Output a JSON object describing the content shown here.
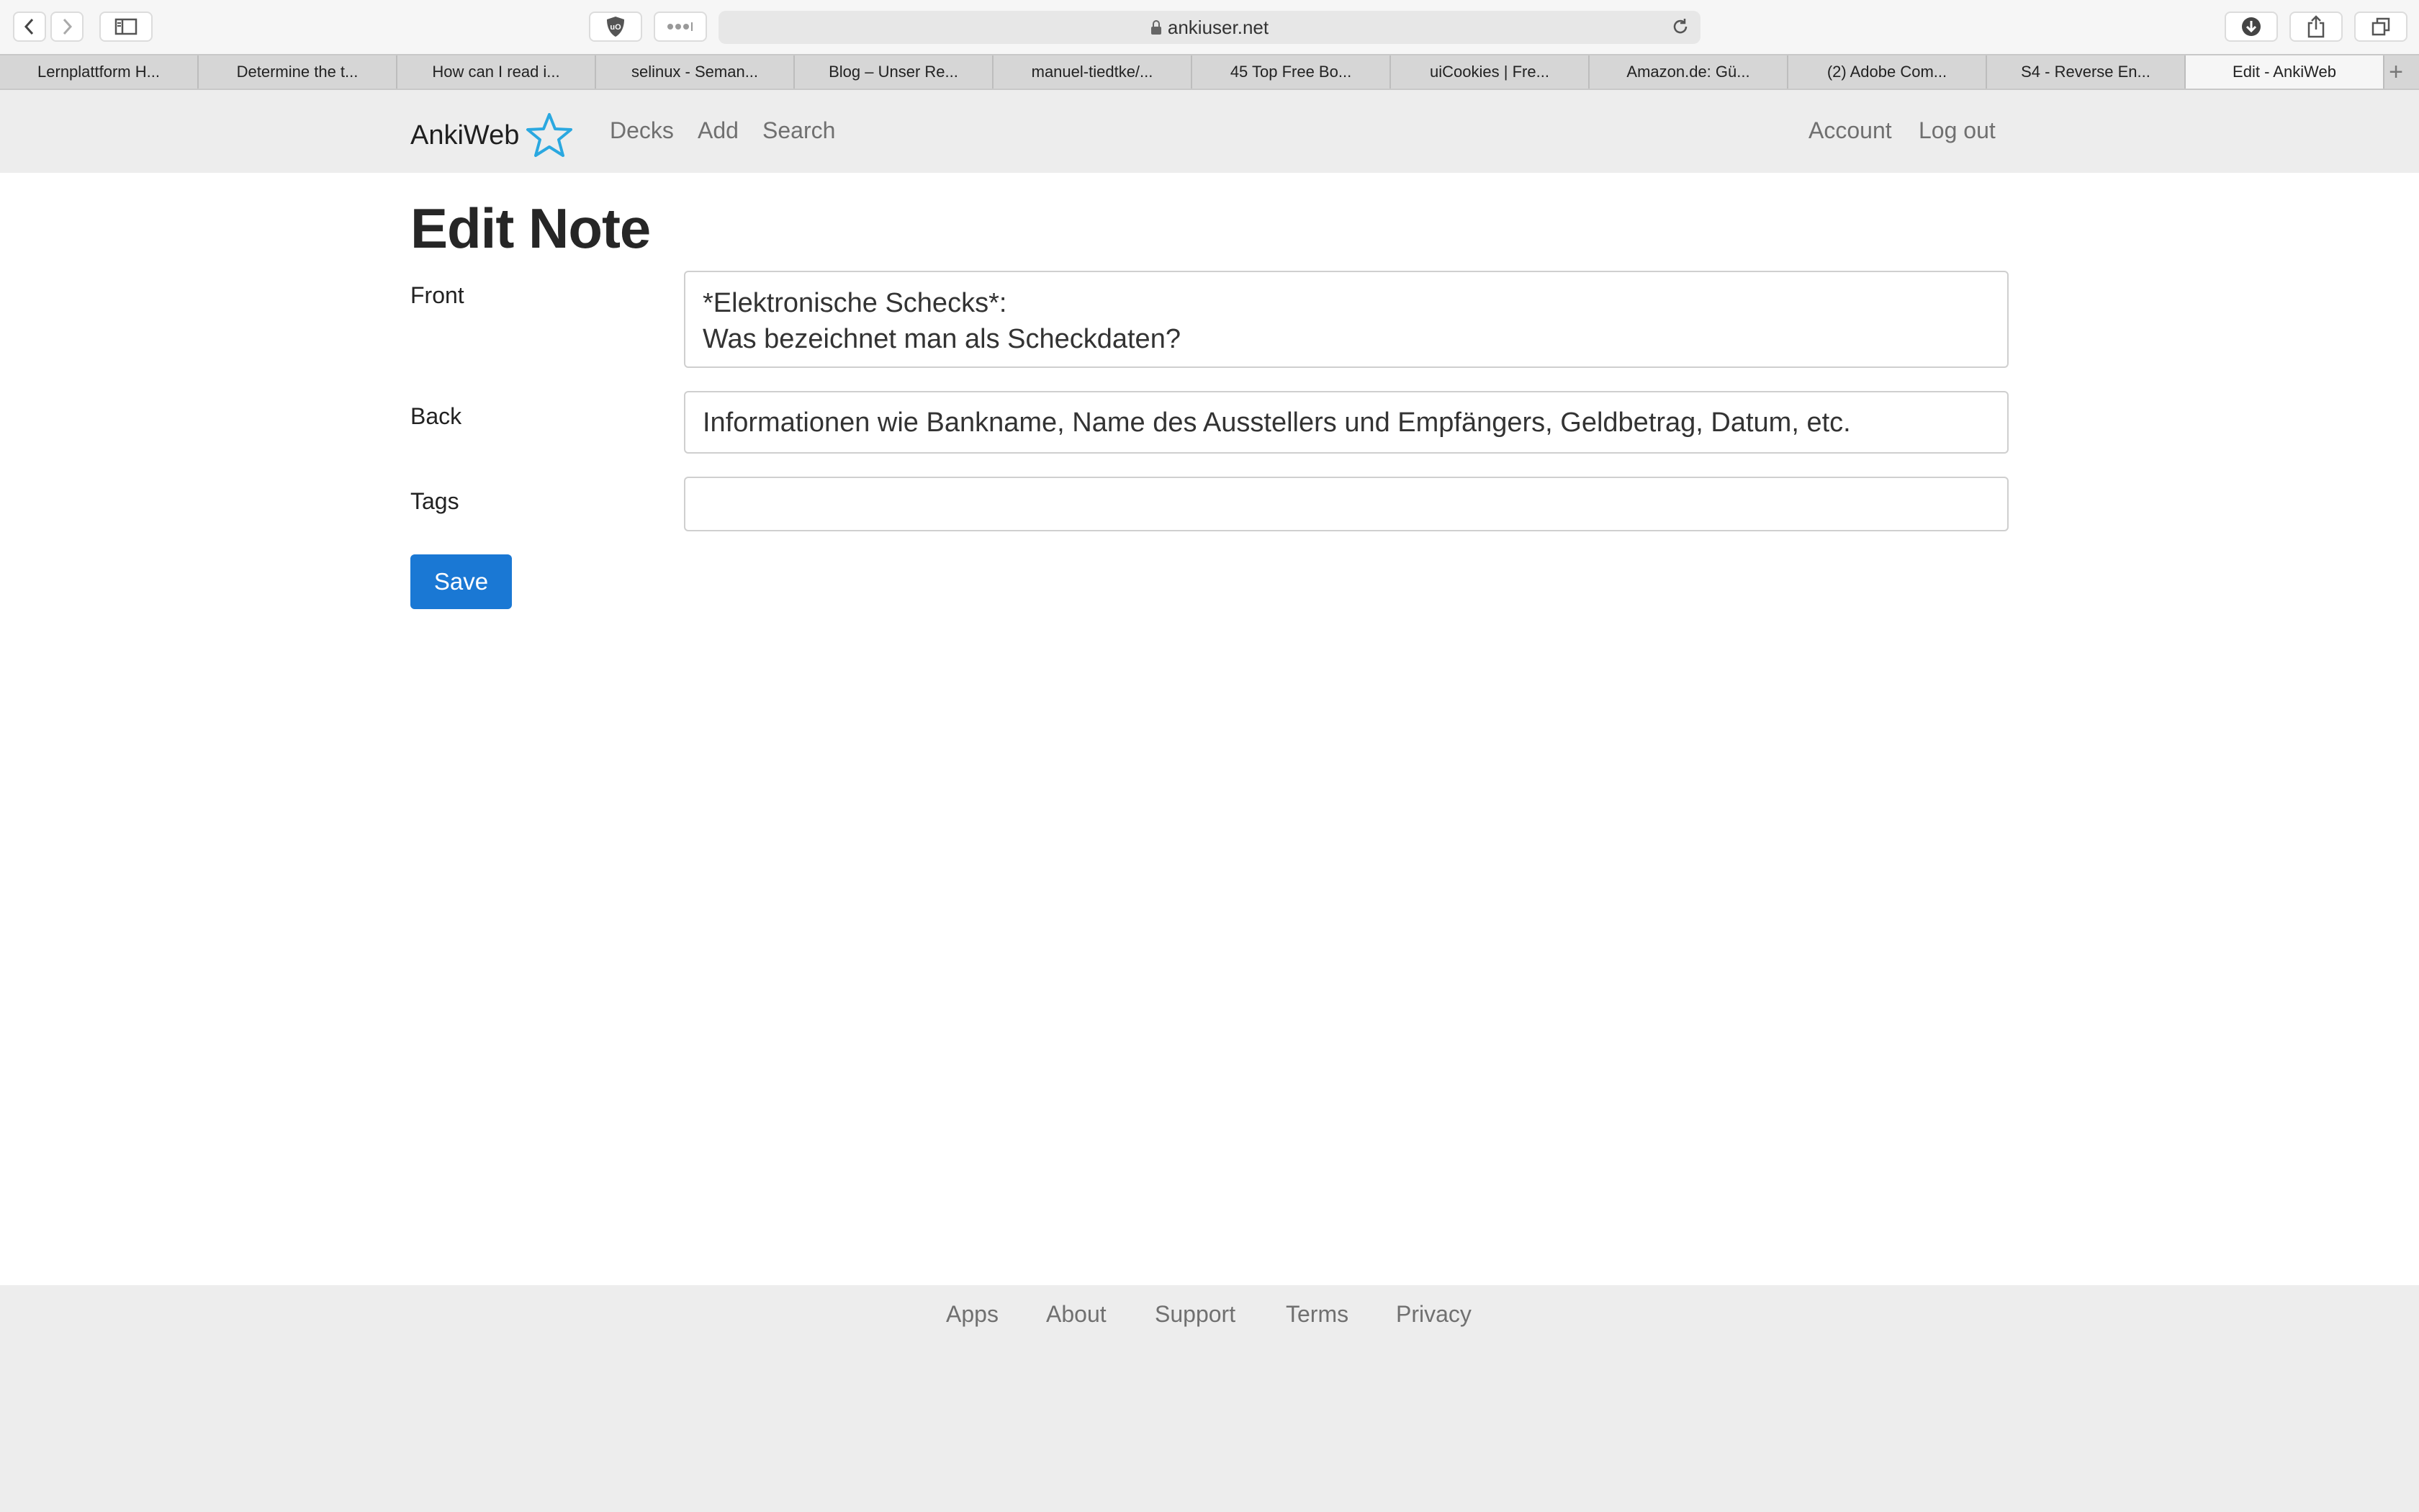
{
  "browser": {
    "url": "ankiuser.net",
    "tabs": [
      "Lernplattform H...",
      "Determine the t...",
      "How can I read i...",
      "selinux - Seman...",
      "Blog – Unser Re...",
      "manuel-tiedtke/...",
      "45 Top Free Bo...",
      "uiCookies | Fre...",
      "Amazon.de: Gü...",
      "(2) Adobe Com...",
      "S4 - Reverse En...",
      "Edit - AnkiWeb"
    ],
    "new_tab_label": "+"
  },
  "nav": {
    "brand": "AnkiWeb",
    "decks": "Decks",
    "add": "Add",
    "search": "Search",
    "account": "Account",
    "logout": "Log out"
  },
  "page": {
    "title": "Edit Note",
    "front_label": "Front",
    "front_line1": "*Elektronische Schecks*:",
    "front_line2": "Was bezeichnet man als Scheckdaten?",
    "back_label": "Back",
    "back_value": "Informationen wie Bankname, Name des Ausstellers und Empfängers, Geldbetrag, Datum, etc.",
    "tags_label": "Tags",
    "tags_value": "",
    "save_label": "Save"
  },
  "footer": {
    "apps": "Apps",
    "about": "About",
    "support": "Support",
    "terms": "Terms",
    "privacy": "Privacy"
  },
  "colors": {
    "accent": "#1a78d4",
    "logo": "#2aa8e0"
  }
}
